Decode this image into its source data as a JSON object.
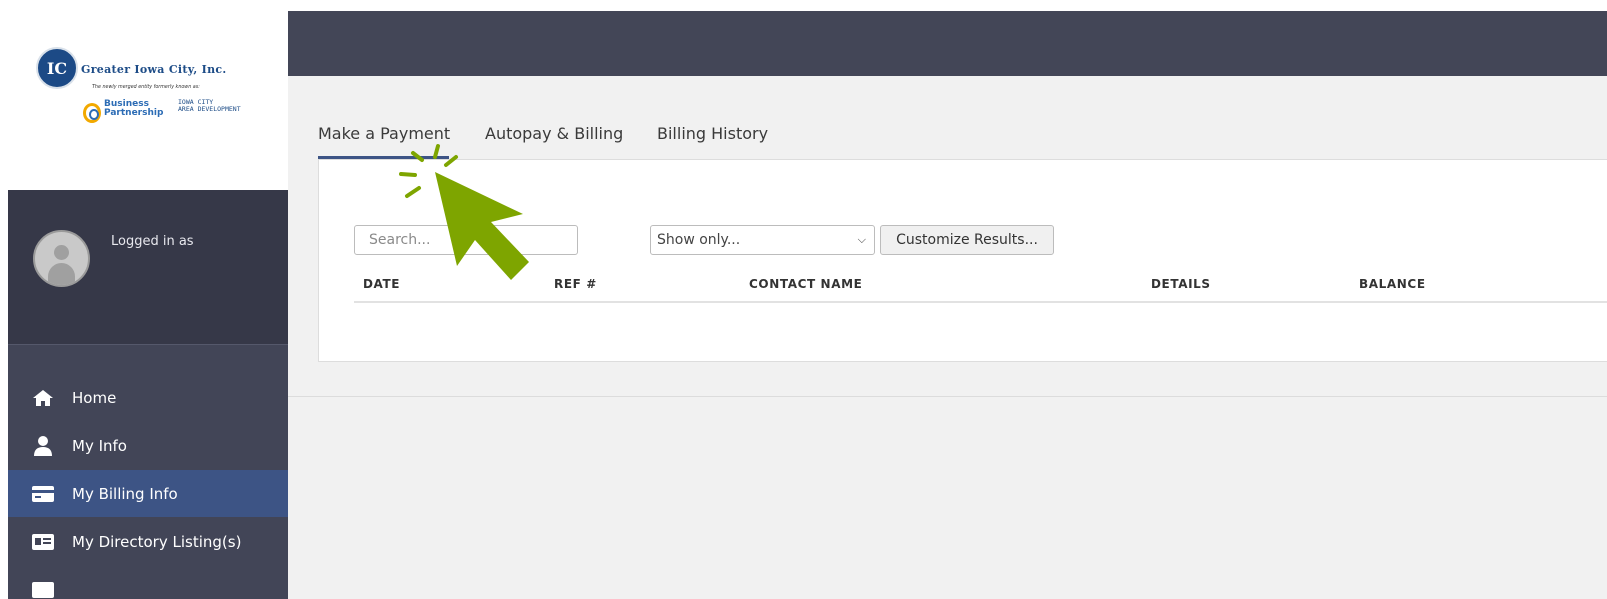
{
  "logo": {
    "seal_text": "IC",
    "org_name": "Greater Iowa City, Inc.",
    "tagline": "The newly merged entity formerly known as:",
    "partner_1": "Business\nPartnership",
    "partner_2": "IOWA CITY\nAREA DEVELOPMENT"
  },
  "user": {
    "logged_in_label": "Logged in as"
  },
  "sidebar": {
    "items": [
      {
        "label": "Home",
        "icon": "home-icon"
      },
      {
        "label": "My Info",
        "icon": "user-icon"
      },
      {
        "label": "My Billing Info",
        "icon": "credit-card-icon",
        "active": true
      },
      {
        "label": "My Directory Listing(s)",
        "icon": "id-card-icon"
      }
    ]
  },
  "tabs": [
    {
      "label": "Make a Payment",
      "active": true
    },
    {
      "label": "Autopay & Billing"
    },
    {
      "label": "Billing History"
    }
  ],
  "search": {
    "placeholder": "Search..."
  },
  "filter": {
    "selected": "Show only..."
  },
  "customize_label": "Customize Results...",
  "table": {
    "columns": [
      "DATE",
      "REF #",
      "CONTACT NAME",
      "DETAILS",
      "BALANCE"
    ]
  },
  "colors": {
    "sidebar": "#424557",
    "active_nav": "#3d5485",
    "cursor": "#7ea500"
  }
}
